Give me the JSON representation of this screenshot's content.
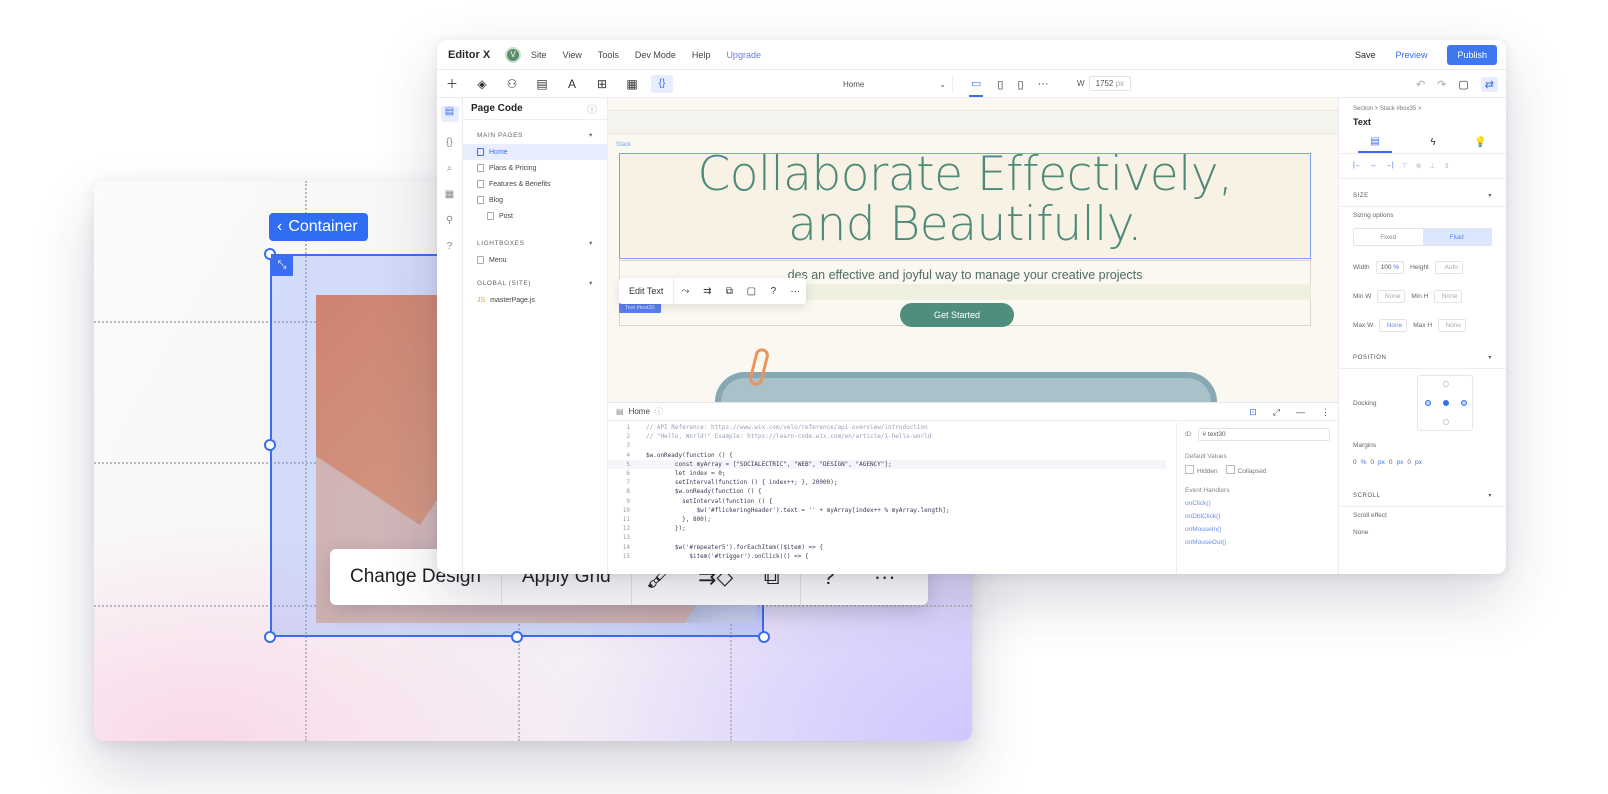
{
  "canvas_mockup": {
    "container_label": "Container",
    "toolbar": {
      "change_design": "Change Design",
      "apply_grid": "Apply Grid",
      "icons": [
        "brush-icon",
        "animation-icon",
        "layout-icon",
        "help-icon",
        "more-icon"
      ]
    }
  },
  "editor": {
    "brand": "Editor X",
    "avatar_initial": "V",
    "menu": [
      "Site",
      "View",
      "Tools",
      "Dev Mode",
      "Help",
      "Upgrade"
    ],
    "save": "Save",
    "preview": "Preview",
    "publish": "Publish",
    "page_select": "Home",
    "width_label": "W",
    "width_value": "1752",
    "width_unit": "px",
    "page_code": {
      "title": "Page Code",
      "main_pages_header": "MAIN PAGES",
      "pages": [
        "Home",
        "Plans & Pricing",
        "Features & Benefits",
        "Blog",
        "Post"
      ],
      "lightboxes_header": "LIGHTBOXES",
      "lightboxes": [
        "Menu"
      ],
      "global_header": "GLOBAL (SITE)",
      "global_files": [
        "masterPage.js"
      ]
    },
    "stage": {
      "stack_label": "Stack",
      "title_line1": "Collaborate Effectively,",
      "title_line2": "and Beautifully.",
      "subtitle": "des an effective and joyful way to manage your creative projects",
      "cta": "Get Started",
      "edit_text": "Edit Text",
      "text_tag": "Text #text30"
    },
    "code": {
      "tab": "Home",
      "lines": [
        {
          "n": "1",
          "t": "// API Reference: https://www.wix.com/velo/reference/api-overview/introduction",
          "c": true
        },
        {
          "n": "2",
          "t": "// \"Hello, World!\" Example: https://learn-code.wix.com/en/article/1-hello-world",
          "c": true
        },
        {
          "n": "3",
          "t": ""
        },
        {
          "n": "4",
          "t": "$w.onReady(function () {"
        },
        {
          "n": "5",
          "t": "        const myArray = [\"SOCIALECTRIC\", \"WEB\", \"DESIGN\", \"AGENCY\"];",
          "h": true
        },
        {
          "n": "6",
          "t": "        let index = 0;"
        },
        {
          "n": "7",
          "t": "        setInterval(function () { index++; }, 20000);"
        },
        {
          "n": "8",
          "t": "        $w.onReady(function () {"
        },
        {
          "n": "9",
          "t": "          setInterval(function () {"
        },
        {
          "n": "10",
          "t": "              $w('#flickeringHeader').text = '' + myArray[index++ % myArray.length];"
        },
        {
          "n": "11",
          "t": "          }, 800);"
        },
        {
          "n": "12",
          "t": "        });"
        },
        {
          "n": "13",
          "t": ""
        },
        {
          "n": "14",
          "t": "        $w('#repeater5').forEachItem(($item) => {"
        },
        {
          "n": "15",
          "t": "            $item('#trigger').onClick(() => {"
        }
      ],
      "props": {
        "id_label": "ID",
        "id_value": "# text30",
        "default_values": "Default Values",
        "hidden": "Hidden",
        "collapsed": "Collapsed",
        "event_handlers": "Event Handlers",
        "events": [
          "onClick()",
          "onDblClick()",
          "onMouseIn()",
          "onMouseOut()"
        ]
      }
    },
    "inspector": {
      "breadcrumb": "Section  >  Stack #box35  >",
      "title": "Text",
      "size_header": "SIZE",
      "sizing_options": "Sizing options",
      "fixed": "Fixed",
      "fluid": "Fluid",
      "width_label": "Width",
      "width_value": "100",
      "width_unit": "%",
      "height_label": "Height",
      "height_value": "Auto",
      "min_w": "Min W",
      "min_h": "Min H",
      "max_w": "Max W",
      "max_h": "Max H",
      "none": "None",
      "position_header": "POSITION",
      "docking": "Docking",
      "margins": "Margins",
      "margin_values": [
        "0",
        "%",
        "0",
        "px",
        "0",
        "px",
        "0",
        "px"
      ],
      "scroll_header": "SCROLL",
      "scroll_effect": "Scroll effect",
      "scroll_value": "None"
    }
  },
  "colors": {
    "accent": "#3a6df0",
    "hero_text": "#4e8a7a",
    "cta": "#4f8d7c",
    "publish": "#3d78f0"
  }
}
